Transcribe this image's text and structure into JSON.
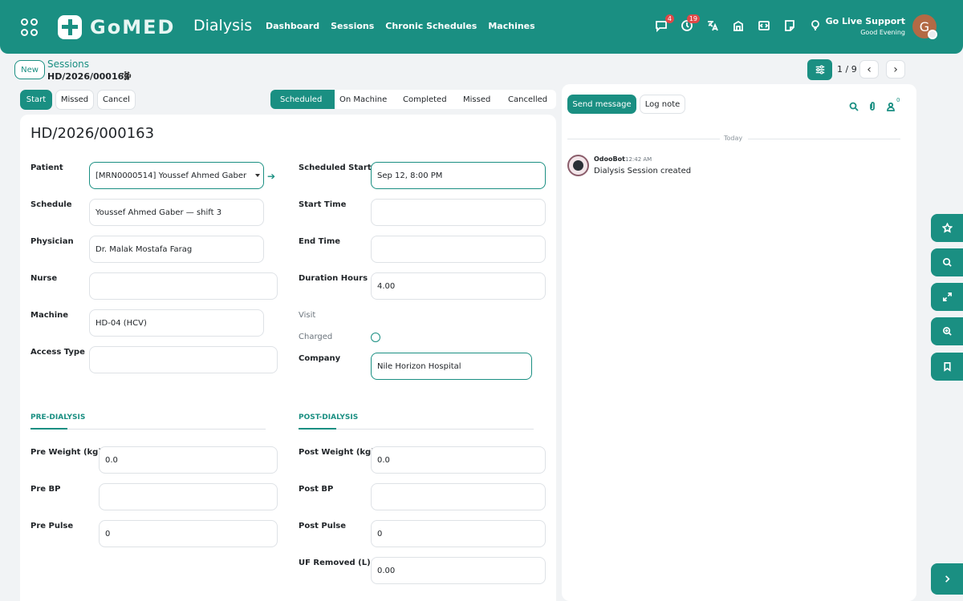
{
  "navbar": {
    "app_title": "Dialysis",
    "logo_text": "GoMED",
    "menu": [
      "Dashboard",
      "Sessions",
      "Chronic Schedules",
      "Machines"
    ],
    "messages_badge": "4",
    "activity_badge": "19",
    "support_name": "Go Live Support",
    "greeting": "Good Evening",
    "avatar_initial": "G",
    "accent_color": "#1a8f82"
  },
  "control": {
    "new_label": "New",
    "breadcrumb_parent": "Sessions",
    "breadcrumb_current": "HD/2026/000163",
    "pager": "1 / 9"
  },
  "actions": {
    "start": "Start",
    "missed": "Missed",
    "cancel": "Cancel"
  },
  "stages": [
    "Scheduled",
    "On Machine",
    "Completed",
    "Missed",
    "Cancelled"
  ],
  "form": {
    "title": "HD/2026/000163",
    "patient_label": "Patient",
    "patient_value": "[MRN0000514] Youssef Ahmed Gaber",
    "schedule_label": "Schedule",
    "schedule_value": "Youssef Ahmed Gaber — shift 3",
    "physician_label": "Physician",
    "physician_value": "Dr. Malak Mostafa Farag",
    "nurse_label": "Nurse",
    "nurse_value": "",
    "machine_label": "Machine",
    "machine_value": "HD-04 (HCV)",
    "access_label": "Access Type",
    "access_value": "",
    "sched_start_label": "Scheduled Start",
    "sched_start_value": "Sep 12, 8:00 PM",
    "start_time_label": "Start Time",
    "start_time_value": "",
    "end_time_label": "End Time",
    "end_time_value": "",
    "duration_label": "Duration Hours",
    "duration_value": "4.00",
    "visit_label": "Visit",
    "charged_label": "Charged",
    "company_label": "Company",
    "company_value": "Nile Horizon Hospital",
    "pre_title": "PRE-DIALYSIS",
    "post_title": "POST-DIALYSIS",
    "pre_weight_label": "Pre Weight (kg)",
    "pre_weight_value": "0.0",
    "pre_bp_label": "Pre BP",
    "pre_bp_value": "",
    "pre_pulse_label": "Pre Pulse",
    "pre_pulse_value": "0",
    "post_weight_label": "Post Weight (kg)",
    "post_weight_value": "0.0",
    "post_bp_label": "Post BP",
    "post_bp_value": "",
    "post_pulse_label": "Post Pulse",
    "post_pulse_value": "0",
    "uf_label": "UF Removed (L)",
    "uf_value": "0.00"
  },
  "chatter": {
    "send_message": "Send message",
    "log_note": "Log note",
    "followers_count": "0",
    "date_separator": "Today",
    "messages": [
      {
        "author": "OdooBot",
        "time": "12:42 AM",
        "body": "Dialysis Session created"
      }
    ]
  }
}
